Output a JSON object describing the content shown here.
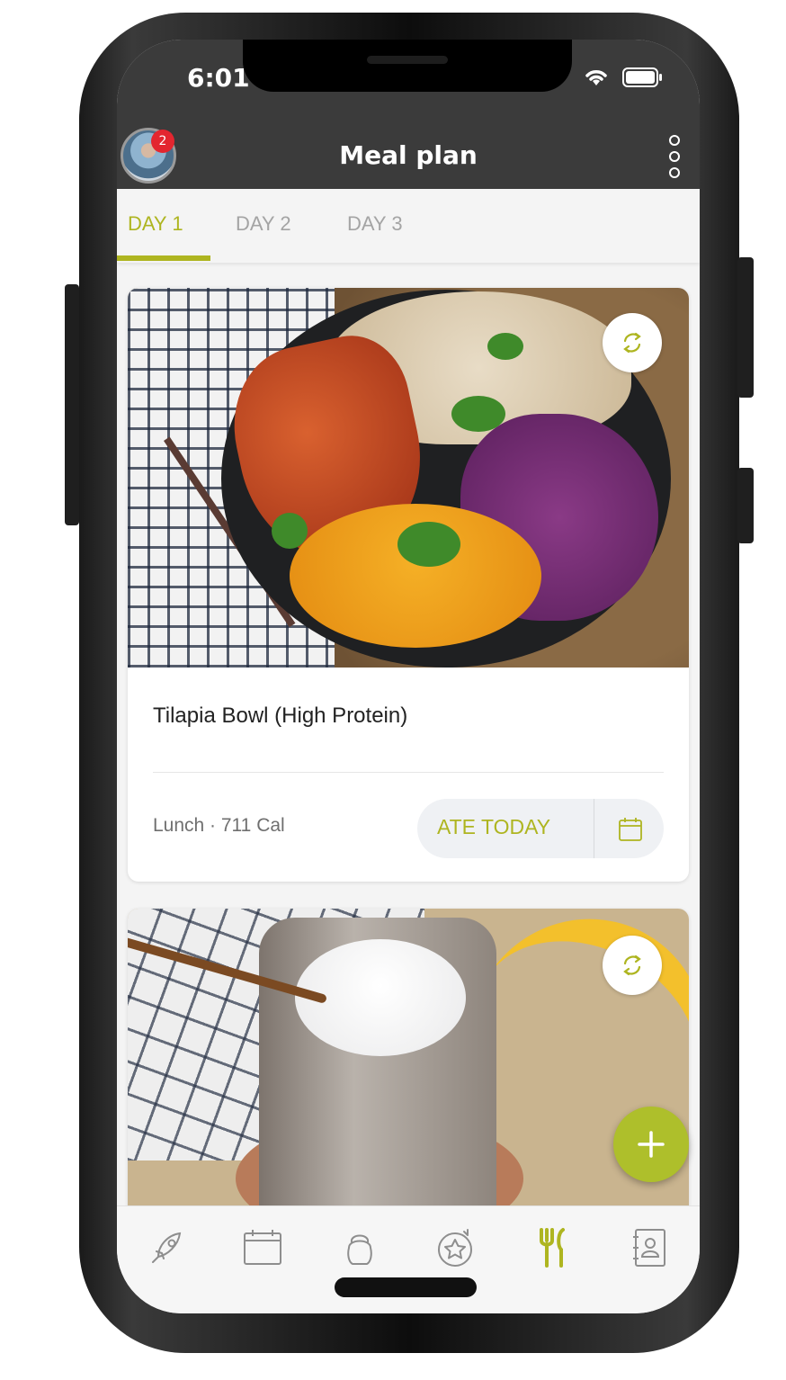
{
  "status_bar": {
    "time": "6:01"
  },
  "header": {
    "title": "Meal plan",
    "notification_count": "2"
  },
  "tabs": [
    {
      "label": "DAY 1",
      "active": true
    },
    {
      "label": "DAY 2",
      "active": false
    },
    {
      "label": "DAY 3",
      "active": false
    }
  ],
  "meals": [
    {
      "name": "Tilapia Bowl (High Protein)",
      "meta": "Lunch · 711 Cal",
      "ate_label": "ATE TODAY"
    },
    {
      "name": "",
      "meta": "",
      "ate_label": ""
    }
  ],
  "bottom_nav": [
    {
      "icon": "rocket-icon",
      "active": false
    },
    {
      "icon": "calendar-icon",
      "active": false
    },
    {
      "icon": "kettlebell-icon",
      "active": false
    },
    {
      "icon": "star-badge-icon",
      "active": false
    },
    {
      "icon": "fork-knife-icon",
      "active": true
    },
    {
      "icon": "contacts-book-icon",
      "active": false
    }
  ],
  "colors": {
    "accent": "#aeb520",
    "header_bg": "#3b3b3b",
    "badge": "#e3262f",
    "fab": "#aebf2b"
  }
}
